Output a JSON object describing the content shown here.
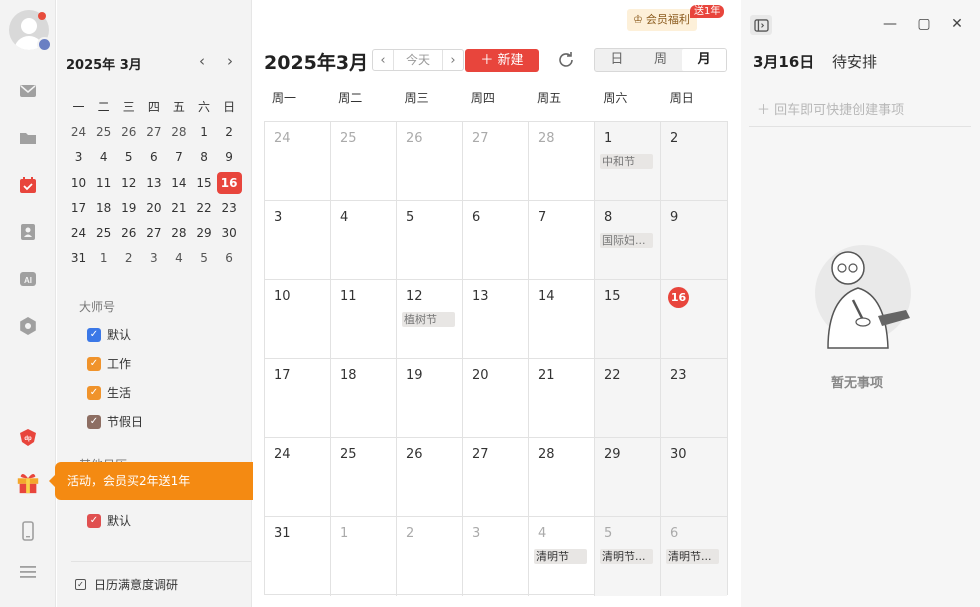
{
  "sidebar": {
    "icons": [
      "mail-icon",
      "folder-icon",
      "calendar-icon",
      "contacts-icon",
      "ai-icon",
      "settings-icon",
      "brand-icon",
      "gift-icon",
      "phone-icon",
      "menu-icon"
    ]
  },
  "mini_calendar": {
    "title": "2025年 3月",
    "weekdays": [
      "一",
      "二",
      "三",
      "四",
      "五",
      "六",
      "日"
    ],
    "weeks": [
      [
        "24",
        "25",
        "26",
        "27",
        "28",
        "1",
        "2"
      ],
      [
        "3",
        "4",
        "5",
        "6",
        "7",
        "8",
        "9"
      ],
      [
        "10",
        "11",
        "12",
        "13",
        "14",
        "15",
        "16"
      ],
      [
        "17",
        "18",
        "19",
        "20",
        "21",
        "22",
        "23"
      ],
      [
        "24",
        "25",
        "26",
        "27",
        "28",
        "29",
        "30"
      ],
      [
        "31",
        "1",
        "2",
        "3",
        "4",
        "5",
        "6"
      ]
    ],
    "today": "16"
  },
  "calendars": {
    "section_title": "大师号",
    "items": [
      {
        "label": "默认",
        "color": "#3b78e7"
      },
      {
        "label": "工作",
        "color": "#f0932b"
      },
      {
        "label": "生活",
        "color": "#f0932b"
      },
      {
        "label": "节假日",
        "color": "#8d6e63"
      }
    ],
    "other_title": "其他日历",
    "other_items": [
      {
        "label": "默认",
        "color": "#e05050"
      }
    ],
    "survey_label": "日历满意度调研"
  },
  "toast": {
    "text": "活动，会员买2年送1年",
    "close": "×"
  },
  "header": {
    "title": "2025年3月",
    "today_label": "今天",
    "new_label": "＋ 新建",
    "views": [
      "日",
      "周",
      "月"
    ],
    "active_view": "月",
    "vip_label": "会员福利",
    "vip_badge": "送1年"
  },
  "month": {
    "weekdays": [
      "周一",
      "周二",
      "周三",
      "周四",
      "周五",
      "周六",
      "周日"
    ],
    "weeks": [
      [
        {
          "d": "24",
          "o": true
        },
        {
          "d": "25",
          "o": true
        },
        {
          "d": "26",
          "o": true
        },
        {
          "d": "27",
          "o": true
        },
        {
          "d": "28",
          "o": true
        },
        {
          "d": "1",
          "e": "中和节"
        },
        {
          "d": "2"
        }
      ],
      [
        {
          "d": "3"
        },
        {
          "d": "4"
        },
        {
          "d": "5"
        },
        {
          "d": "6"
        },
        {
          "d": "7"
        },
        {
          "d": "8",
          "e": "国际妇..."
        },
        {
          "d": "9"
        }
      ],
      [
        {
          "d": "10"
        },
        {
          "d": "11"
        },
        {
          "d": "12",
          "e": "植树节"
        },
        {
          "d": "13"
        },
        {
          "d": "14"
        },
        {
          "d": "15"
        },
        {
          "d": "16",
          "t": true
        }
      ],
      [
        {
          "d": "17"
        },
        {
          "d": "18"
        },
        {
          "d": "19"
        },
        {
          "d": "20"
        },
        {
          "d": "21"
        },
        {
          "d": "22"
        },
        {
          "d": "23"
        }
      ],
      [
        {
          "d": "24"
        },
        {
          "d": "25"
        },
        {
          "d": "26"
        },
        {
          "d": "27"
        },
        {
          "d": "28"
        },
        {
          "d": "29"
        },
        {
          "d": "30"
        }
      ],
      [
        {
          "d": "31"
        },
        {
          "d": "1",
          "o": true
        },
        {
          "d": "2",
          "o": true
        },
        {
          "d": "3",
          "o": true
        },
        {
          "d": "4",
          "o": true,
          "e": "清明节",
          "dark": true
        },
        {
          "d": "5",
          "o": true,
          "e": "清明节...",
          "dark": true
        },
        {
          "d": "6",
          "o": true,
          "e": "清明节...",
          "dark": true
        }
      ]
    ]
  },
  "right_pane": {
    "date": "3月16日",
    "status": "待安排",
    "quick_add": "＋ 回车即可快捷创建事项",
    "empty_text": "暂无事项"
  }
}
